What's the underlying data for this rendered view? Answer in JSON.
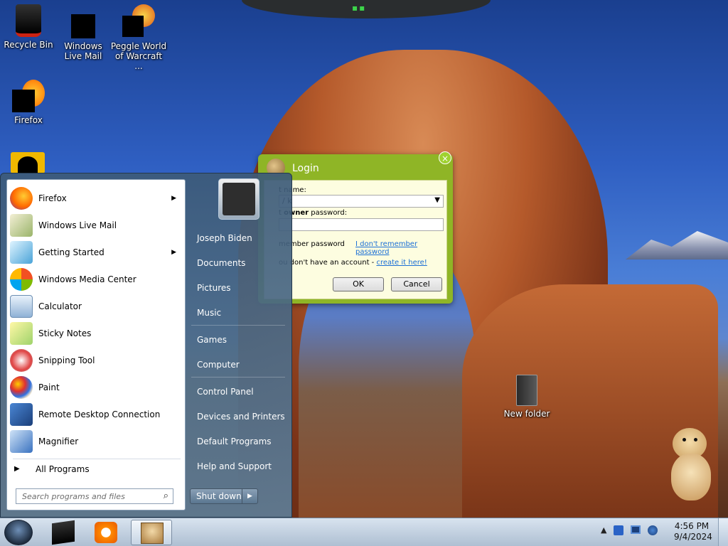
{
  "desktop": {
    "icons": [
      {
        "label": "Recycle Bin",
        "icon": "recycle-bin-icon"
      },
      {
        "label": "Windows Live Mail",
        "icon": "windows-live-mail-icon"
      },
      {
        "label": "Peggle World of Warcraft ...",
        "icon": "peggle-icon"
      },
      {
        "label": "Firefox",
        "icon": "firefox-icon"
      },
      {
        "label": "New folder",
        "icon": "folder-icon"
      }
    ]
  },
  "login_dialog": {
    "title": "Login",
    "close_glyph": "×",
    "user_label": "t name:",
    "user_value": "/ k",
    "owner_label_pre": "t ",
    "owner_label_bold": "owner",
    "owner_label_post": " password:",
    "remember_label": "member password",
    "forgot_link": "I don't remember password",
    "no_account_text": "ou don't have an account - ",
    "create_link": "create it here!",
    "ok_button": "OK",
    "cancel_button": "Cancel"
  },
  "start_menu": {
    "programs": [
      {
        "label": "Firefox",
        "icon": "firefox-icon",
        "submenu": true
      },
      {
        "label": "Windows Live Mail",
        "icon": "windows-live-mail-icon",
        "submenu": false
      },
      {
        "label": "Getting Started",
        "icon": "getting-started-icon",
        "submenu": true
      },
      {
        "label": "Windows Media Center",
        "icon": "media-center-icon",
        "submenu": false
      },
      {
        "label": "Calculator",
        "icon": "calculator-icon",
        "submenu": false
      },
      {
        "label": "Sticky Notes",
        "icon": "sticky-notes-icon",
        "submenu": false
      },
      {
        "label": "Snipping Tool",
        "icon": "snipping-tool-icon",
        "submenu": false
      },
      {
        "label": "Paint",
        "icon": "paint-icon",
        "submenu": false
      },
      {
        "label": "Remote Desktop Connection",
        "icon": "remote-desktop-icon",
        "submenu": false
      },
      {
        "label": "Magnifier",
        "icon": "magnifier-icon",
        "submenu": false
      }
    ],
    "all_programs": "All Programs",
    "search_placeholder": "Search programs and files",
    "right_items": [
      "Joseph Biden",
      "Documents",
      "Pictures",
      "Music",
      "Games",
      "Computer",
      "Control Panel",
      "Devices and Printers",
      "Default Programs",
      "Help and Support"
    ],
    "shutdown": "Shut down"
  },
  "taskbar": {
    "time": "4:56 PM",
    "date": "9/4/2024",
    "tray_arrow": "▲",
    "pinned": [
      "windows-live-mail-icon",
      "media-player-icon",
      "box-app-icon"
    ]
  },
  "colors": {
    "login_green": "#8fb526",
    "link_blue": "#1a6ed6",
    "taskbar": "#aebfd2"
  }
}
